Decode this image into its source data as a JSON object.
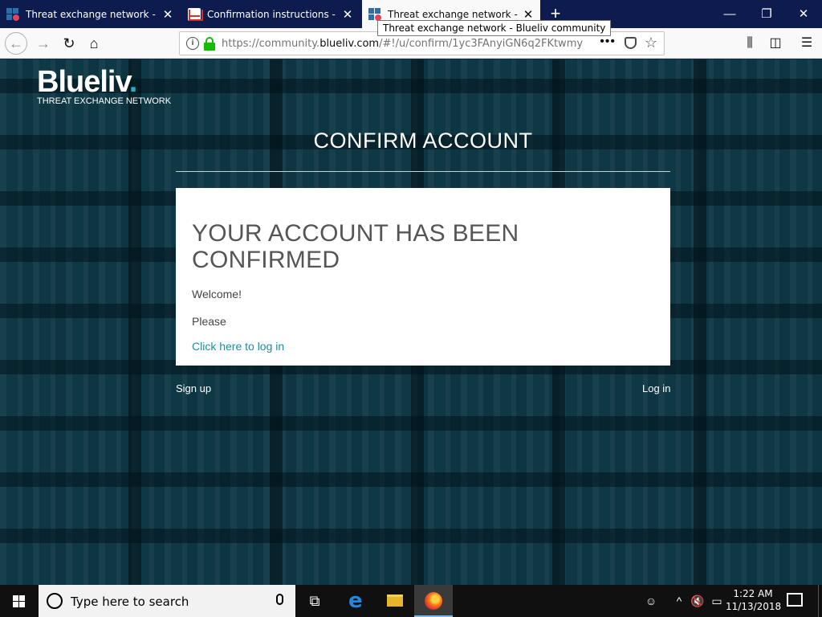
{
  "browser": {
    "tabs": [
      {
        "title": "Threat exchange network - Blueliv community",
        "icon": "blueliv-favicon",
        "active": false
      },
      {
        "title": "Confirmation instructions - tian",
        "icon": "gmail-favicon",
        "active": false
      },
      {
        "title": "Threat exchange network - Blueliv community",
        "icon": "blueliv-favicon",
        "active": true
      }
    ],
    "tooltip": "Threat exchange network - Blueliv community",
    "url": {
      "scheme": "https://community.",
      "host": "blueliv.com",
      "path": "/#!/u/confirm/1yc3FAnyiGN6q2FKtwmy"
    },
    "new_tab_glyph": "+",
    "menu_dots": "•••"
  },
  "page": {
    "logo": {
      "word": "Blueliv",
      "dot": ".",
      "subtitle": "THREAT EXCHANGE NETWORK"
    },
    "heading": "CONFIRM ACCOUNT",
    "card": {
      "title": "YOUR ACCOUNT HAS BEEN CONFIRMED",
      "welcome": "Welcome!",
      "please": "Please",
      "link": "Click here to log in"
    },
    "footer": {
      "signup": "Sign up",
      "login": "Log in"
    }
  },
  "taskbar": {
    "search_placeholder": "Type here to search",
    "time": "1:22 AM",
    "date": "11/13/2018"
  },
  "colors": {
    "tabstrip": "#0d1b4f",
    "link": "#1b8fa6",
    "lock": "#12bc00",
    "logo_dot": "#1fb0c9",
    "page_bg": "#0c3542"
  }
}
